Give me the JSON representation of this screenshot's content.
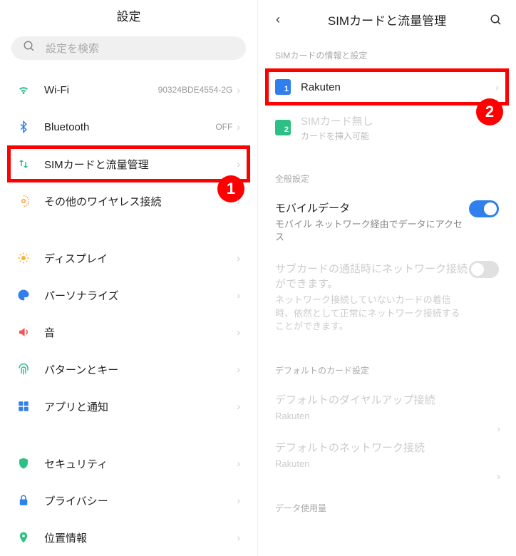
{
  "left": {
    "title": "設定",
    "search_placeholder": "設定を検索",
    "rows": {
      "wifi": {
        "label": "Wi-Fi",
        "value": "90324BDE4554-2G"
      },
      "bt": {
        "label": "Bluetooth",
        "value": "OFF"
      },
      "sim": {
        "label": "SIMカードと流量管理"
      },
      "wireless": {
        "label": "その他のワイヤレス接続"
      },
      "display": {
        "label": "ディスプレイ"
      },
      "personalize": {
        "label": "パーソナライズ"
      },
      "sound": {
        "label": "音"
      },
      "pattern": {
        "label": "パターンとキー"
      },
      "apps": {
        "label": "アプリと通知"
      },
      "security": {
        "label": "セキュリティ"
      },
      "privacy": {
        "label": "プライバシー"
      },
      "location": {
        "label": "位置情報"
      }
    },
    "annotation": "1"
  },
  "right": {
    "title": "SIMカードと流量管理",
    "section_sim": "SIMカードの情報と設定",
    "sim1": {
      "num": "1",
      "name": "Rakuten"
    },
    "sim2": {
      "num": "2",
      "title": "SIMカード無し",
      "sub": "カードを挿入可能"
    },
    "section_general": "全般設定",
    "mobile_data": {
      "title": "モバイルデータ",
      "sub": "モバイル ネットワーク経由でデータにアクセス"
    },
    "sub_card": {
      "title": "サブカードの通話時にネットワーク接続ができます。",
      "sub": "ネットワーク接続していないカードの着信時、依然として正常にネットワーク接続することができます。"
    },
    "section_default": "デフォルトのカード設定",
    "default_dialup": {
      "title": "デフォルトのダイヤルアップ接続",
      "sub": "Rakuten"
    },
    "default_net": {
      "title": "デフォルトのネットワーク接続",
      "sub": "Rakuten"
    },
    "section_data": "データ使用量",
    "annotation": "2"
  }
}
